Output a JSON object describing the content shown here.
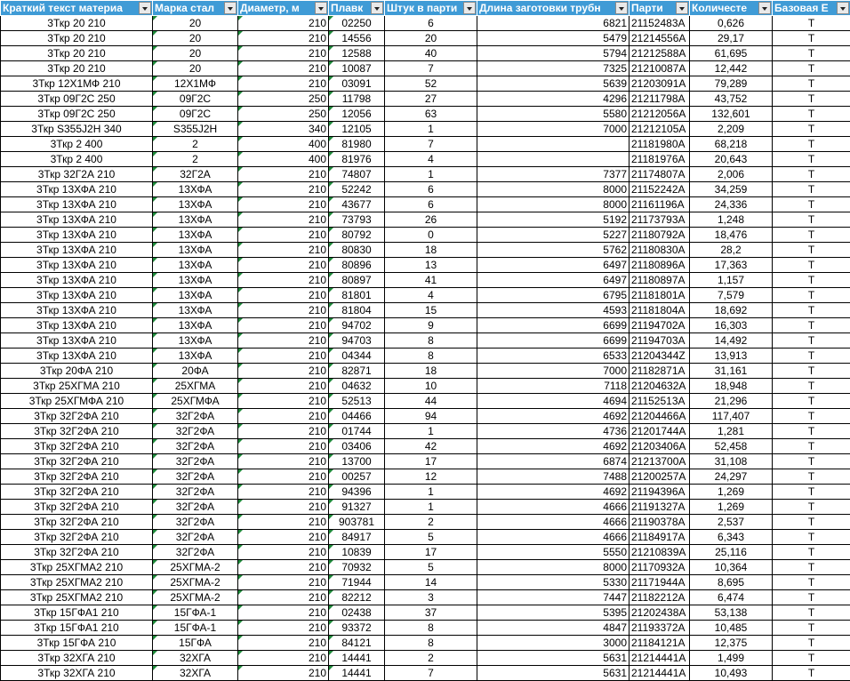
{
  "headers": [
    {
      "label": "Краткий текст материа"
    },
    {
      "label": "Марка стал"
    },
    {
      "label": "Диаметр, м"
    },
    {
      "label": "Плавк"
    },
    {
      "label": "Штук в парти"
    },
    {
      "label": "Длина заготовки трубн"
    },
    {
      "label": "Парти"
    },
    {
      "label": "Количесте"
    },
    {
      "label": "Базовая Е"
    }
  ],
  "rows": [
    [
      "3Ткр 20 210",
      "20",
      "210",
      "02250",
      "6",
      "6821",
      "21152483А",
      "0,626",
      "Т"
    ],
    [
      "3Ткр 20 210",
      "20",
      "210",
      "14556",
      "20",
      "5479",
      "21214556А",
      "29,17",
      "Т"
    ],
    [
      "3Ткр 20 210",
      "20",
      "210",
      "12588",
      "40",
      "5794",
      "21212588А",
      "61,695",
      "Т"
    ],
    [
      "3Ткр 20 210",
      "20",
      "210",
      "10087",
      "7",
      "7325",
      "21210087А",
      "12,442",
      "Т"
    ],
    [
      "3Ткр 12Х1МФ 210",
      "12Х1МФ",
      "210",
      "03091",
      "52",
      "5639",
      "21203091А",
      "79,289",
      "Т"
    ],
    [
      "3Ткр 09Г2С 250",
      "09Г2С",
      "250",
      "11798",
      "27",
      "4296",
      "21211798А",
      "43,752",
      "Т"
    ],
    [
      "3Ткр 09Г2С 250",
      "09Г2С",
      "250",
      "12056",
      "63",
      "5580",
      "21212056А",
      "132,601",
      "Т"
    ],
    [
      "3Ткр S355J2H 340",
      "S355J2H",
      "340",
      "12105",
      "1",
      "7000",
      "21212105А",
      "2,209",
      "Т"
    ],
    [
      "3Ткр 2 400",
      "2",
      "400",
      "81980",
      "7",
      "",
      "21181980А",
      "68,218",
      "Т"
    ],
    [
      "3Ткр 2 400",
      "2",
      "400",
      "81976",
      "4",
      "",
      "21181976А",
      "20,643",
      "Т"
    ],
    [
      "3Ткр 32Г2А 210",
      "32Г2А",
      "210",
      "74807",
      "1",
      "7377",
      "21174807А",
      "2,006",
      "Т"
    ],
    [
      "3Ткр 13ХФА 210",
      "13ХФА",
      "210",
      "52242",
      "6",
      "8000",
      "21152242А",
      "34,259",
      "Т"
    ],
    [
      "3Ткр 13ХФА 210",
      "13ХФА",
      "210",
      "43677",
      "6",
      "8000",
      "21161196А",
      "24,336",
      "Т"
    ],
    [
      "3Ткр 13ХФА 210",
      "13ХФА",
      "210",
      "73793",
      "26",
      "5192",
      "21173793А",
      "1,248",
      "Т"
    ],
    [
      "3Ткр 13ХФА 210",
      "13ХФА",
      "210",
      "80792",
      "0",
      "5227",
      "21180792А",
      "18,476",
      "Т"
    ],
    [
      "3Ткр 13ХФА 210",
      "13ХФА",
      "210",
      "80830",
      "18",
      "5762",
      "21180830А",
      "28,2",
      "Т"
    ],
    [
      "3Ткр 13ХФА 210",
      "13ХФА",
      "210",
      "80896",
      "13",
      "6497",
      "21180896А",
      "17,363",
      "Т"
    ],
    [
      "3Ткр 13ХФА 210",
      "13ХФА",
      "210",
      "80897",
      "41",
      "6497",
      "21180897А",
      "1,157",
      "Т"
    ],
    [
      "3Ткр 13ХФА 210",
      "13ХФА",
      "210",
      "81801",
      "4",
      "6795",
      "21181801А",
      "7,579",
      "Т"
    ],
    [
      "3Ткр 13ХФА 210",
      "13ХФА",
      "210",
      "81804",
      "15",
      "4593",
      "21181804А",
      "18,692",
      "Т"
    ],
    [
      "3Ткр 13ХФА 210",
      "13ХФА",
      "210",
      "94702",
      "9",
      "6699",
      "21194702А",
      "16,303",
      "Т"
    ],
    [
      "3Ткр 13ХФА 210",
      "13ХФА",
      "210",
      "94703",
      "8",
      "6699",
      "21194703А",
      "14,492",
      "Т"
    ],
    [
      "3Ткр 13ХФА 210",
      "13ХФА",
      "210",
      "04344",
      "8",
      "6533",
      "21204344Z",
      "13,913",
      "Т"
    ],
    [
      "3Ткр 20ФА 210",
      "20ФА",
      "210",
      "82871",
      "18",
      "7000",
      "21182871А",
      "31,161",
      "Т"
    ],
    [
      "3Ткр 25ХГМА 210",
      "25ХГМА",
      "210",
      "04632",
      "10",
      "7118",
      "21204632А",
      "18,948",
      "Т"
    ],
    [
      "3Ткр 25ХГМФА 210",
      "25ХГМФА",
      "210",
      "52513",
      "44",
      "4694",
      "21152513А",
      "21,296",
      "Т"
    ],
    [
      "3Ткр 32Г2ФА 210",
      "32Г2ФА",
      "210",
      "04466",
      "94",
      "4692",
      "21204466А",
      "117,407",
      "Т"
    ],
    [
      "3Ткр 32Г2ФА 210",
      "32Г2ФА",
      "210",
      "01744",
      "1",
      "4736",
      "21201744А",
      "1,281",
      "Т"
    ],
    [
      "3Ткр 32Г2ФА 210",
      "32Г2ФА",
      "210",
      "03406",
      "42",
      "4692",
      "21203406А",
      "52,458",
      "Т"
    ],
    [
      "3Ткр 32Г2ФА 210",
      "32Г2ФА",
      "210",
      "13700",
      "17",
      "6874",
      "21213700А",
      "31,108",
      "Т"
    ],
    [
      "3Ткр 32Г2ФА 210",
      "32Г2ФА",
      "210",
      "00257",
      "12",
      "7488",
      "21200257А",
      "24,297",
      "Т"
    ],
    [
      "3Ткр 32Г2ФА 210",
      "32Г2ФА",
      "210",
      "94396",
      "1",
      "4692",
      "21194396А",
      "1,269",
      "Т"
    ],
    [
      "3Ткр 32Г2ФА 210",
      "32Г2ФА",
      "210",
      "91327",
      "1",
      "4666",
      "21191327А",
      "1,269",
      "Т"
    ],
    [
      "3Ткр 32Г2ФА 210",
      "32Г2ФА",
      "210",
      "903781",
      "2",
      "4666",
      "21190378А",
      "2,537",
      "Т"
    ],
    [
      "3Ткр 32Г2ФА 210",
      "32Г2ФА",
      "210",
      "84917",
      "5",
      "4666",
      "21184917А",
      "6,343",
      "Т"
    ],
    [
      "3Ткр 32Г2ФА 210",
      "32Г2ФА",
      "210",
      "10839",
      "17",
      "5550",
      "21210839А",
      "25,116",
      "Т"
    ],
    [
      "3Ткр 25ХГМА2 210",
      "25ХГМА-2",
      "210",
      "70932",
      "5",
      "8000",
      "21170932А",
      "10,364",
      "Т"
    ],
    [
      "3Ткр 25ХГМА2 210",
      "25ХГМА-2",
      "210",
      "71944",
      "14",
      "5330",
      "21171944А",
      "8,695",
      "Т"
    ],
    [
      "3Ткр 25ХГМА2 210",
      "25ХГМА-2",
      "210",
      "82212",
      "3",
      "7447",
      "21182212А",
      "6,474",
      "Т"
    ],
    [
      "3Ткр 15ГФА1 210",
      "15ГФА-1",
      "210",
      "02438",
      "37",
      "5395",
      "21202438А",
      "53,138",
      "Т"
    ],
    [
      "3Ткр 15ГФА1 210",
      "15ГФА-1",
      "210",
      "93372",
      "8",
      "4847",
      "21193372А",
      "10,485",
      "Т"
    ],
    [
      "3Ткр 15ГФА 210",
      "15ГФА",
      "210",
      "84121",
      "8",
      "3000",
      "21184121А",
      "12,375",
      "Т"
    ],
    [
      "3Ткр 32ХГА 210",
      "32ХГА",
      "210",
      "14441",
      "2",
      "5631",
      "21214441А",
      "1,499",
      "Т"
    ],
    [
      "3Ткр 32ХГА 210",
      "32ХГА",
      "210",
      "14441",
      "7",
      "5631",
      "21214441А",
      "10,493",
      "Т"
    ]
  ],
  "colors": {
    "header_bg": "#3f9bd6",
    "header_text": "#ffffff",
    "indicator": "#1e8a3a"
  }
}
